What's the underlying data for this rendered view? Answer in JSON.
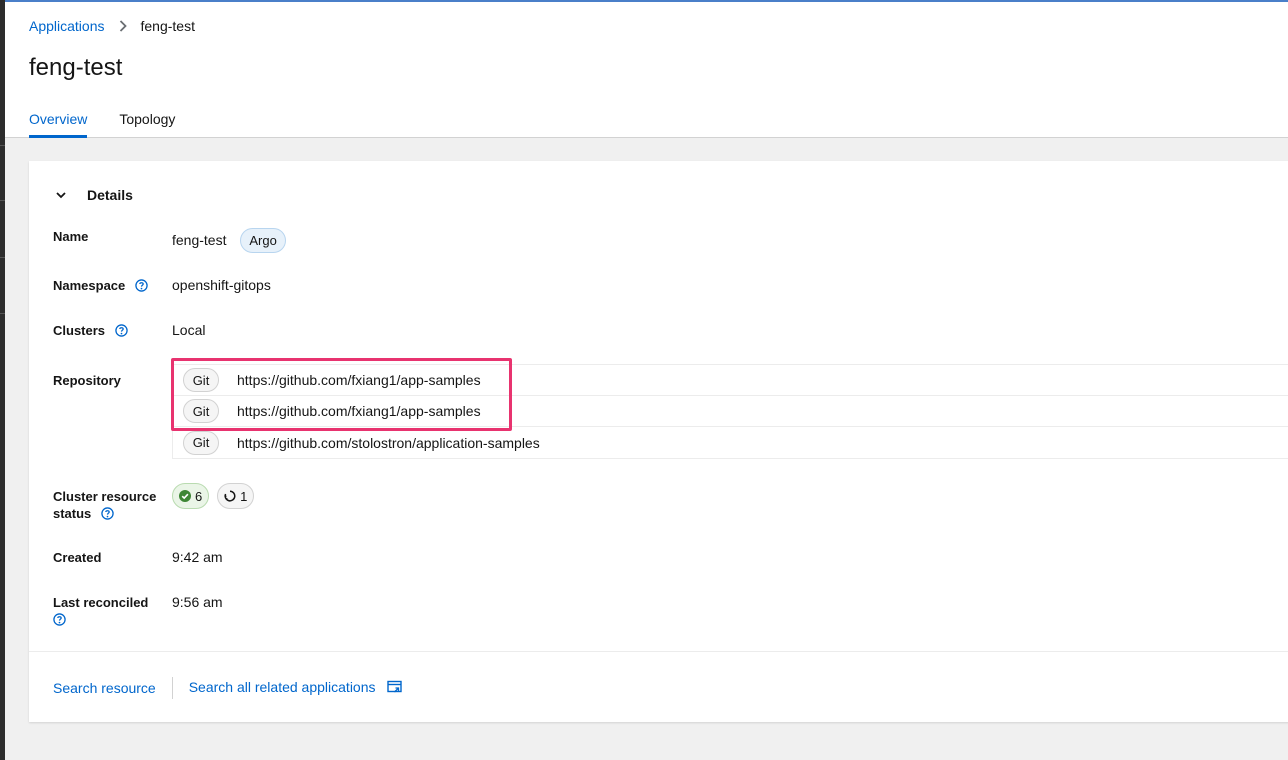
{
  "breadcrumb": {
    "parent": "Applications",
    "current": "feng-test"
  },
  "page": {
    "title": "feng-test"
  },
  "tabs": [
    {
      "label": "Overview",
      "active": true
    },
    {
      "label": "Topology",
      "active": false
    }
  ],
  "details": {
    "section_title": "Details",
    "name_label": "Name",
    "name_value": "feng-test",
    "name_badge": "Argo",
    "namespace_label": "Namespace",
    "namespace_value": "openshift-gitops",
    "clusters_label": "Clusters",
    "clusters_value": "Local",
    "repository_label": "Repository",
    "repositories": [
      {
        "type": "Git",
        "url": "https://github.com/fxiang1/app-samples"
      },
      {
        "type": "Git",
        "url": "https://github.com/fxiang1/app-samples"
      },
      {
        "type": "Git",
        "url": "https://github.com/stolostron/application-samples"
      }
    ],
    "status_label_line1": "Cluster resource",
    "status_label_line2": "status",
    "status_ok_count": "6",
    "status_pending_count": "1",
    "created_label": "Created",
    "created_value": "9:42 am",
    "reconciled_label": "Last reconciled",
    "reconciled_value": "9:56 am"
  },
  "footer": {
    "search_resource": "Search resource",
    "search_related": "Search all related applications"
  },
  "colors": {
    "link": "#0066cc",
    "highlight": "#e8336f",
    "success": "#3e8635"
  },
  "icons": {
    "breadcrumb_separator": "chevron-right-icon",
    "section_toggle": "chevron-down-icon",
    "help": "help-circle-icon",
    "status_ok": "check-circle-icon",
    "status_pending": "in-progress-icon",
    "external": "external-window-icon"
  }
}
